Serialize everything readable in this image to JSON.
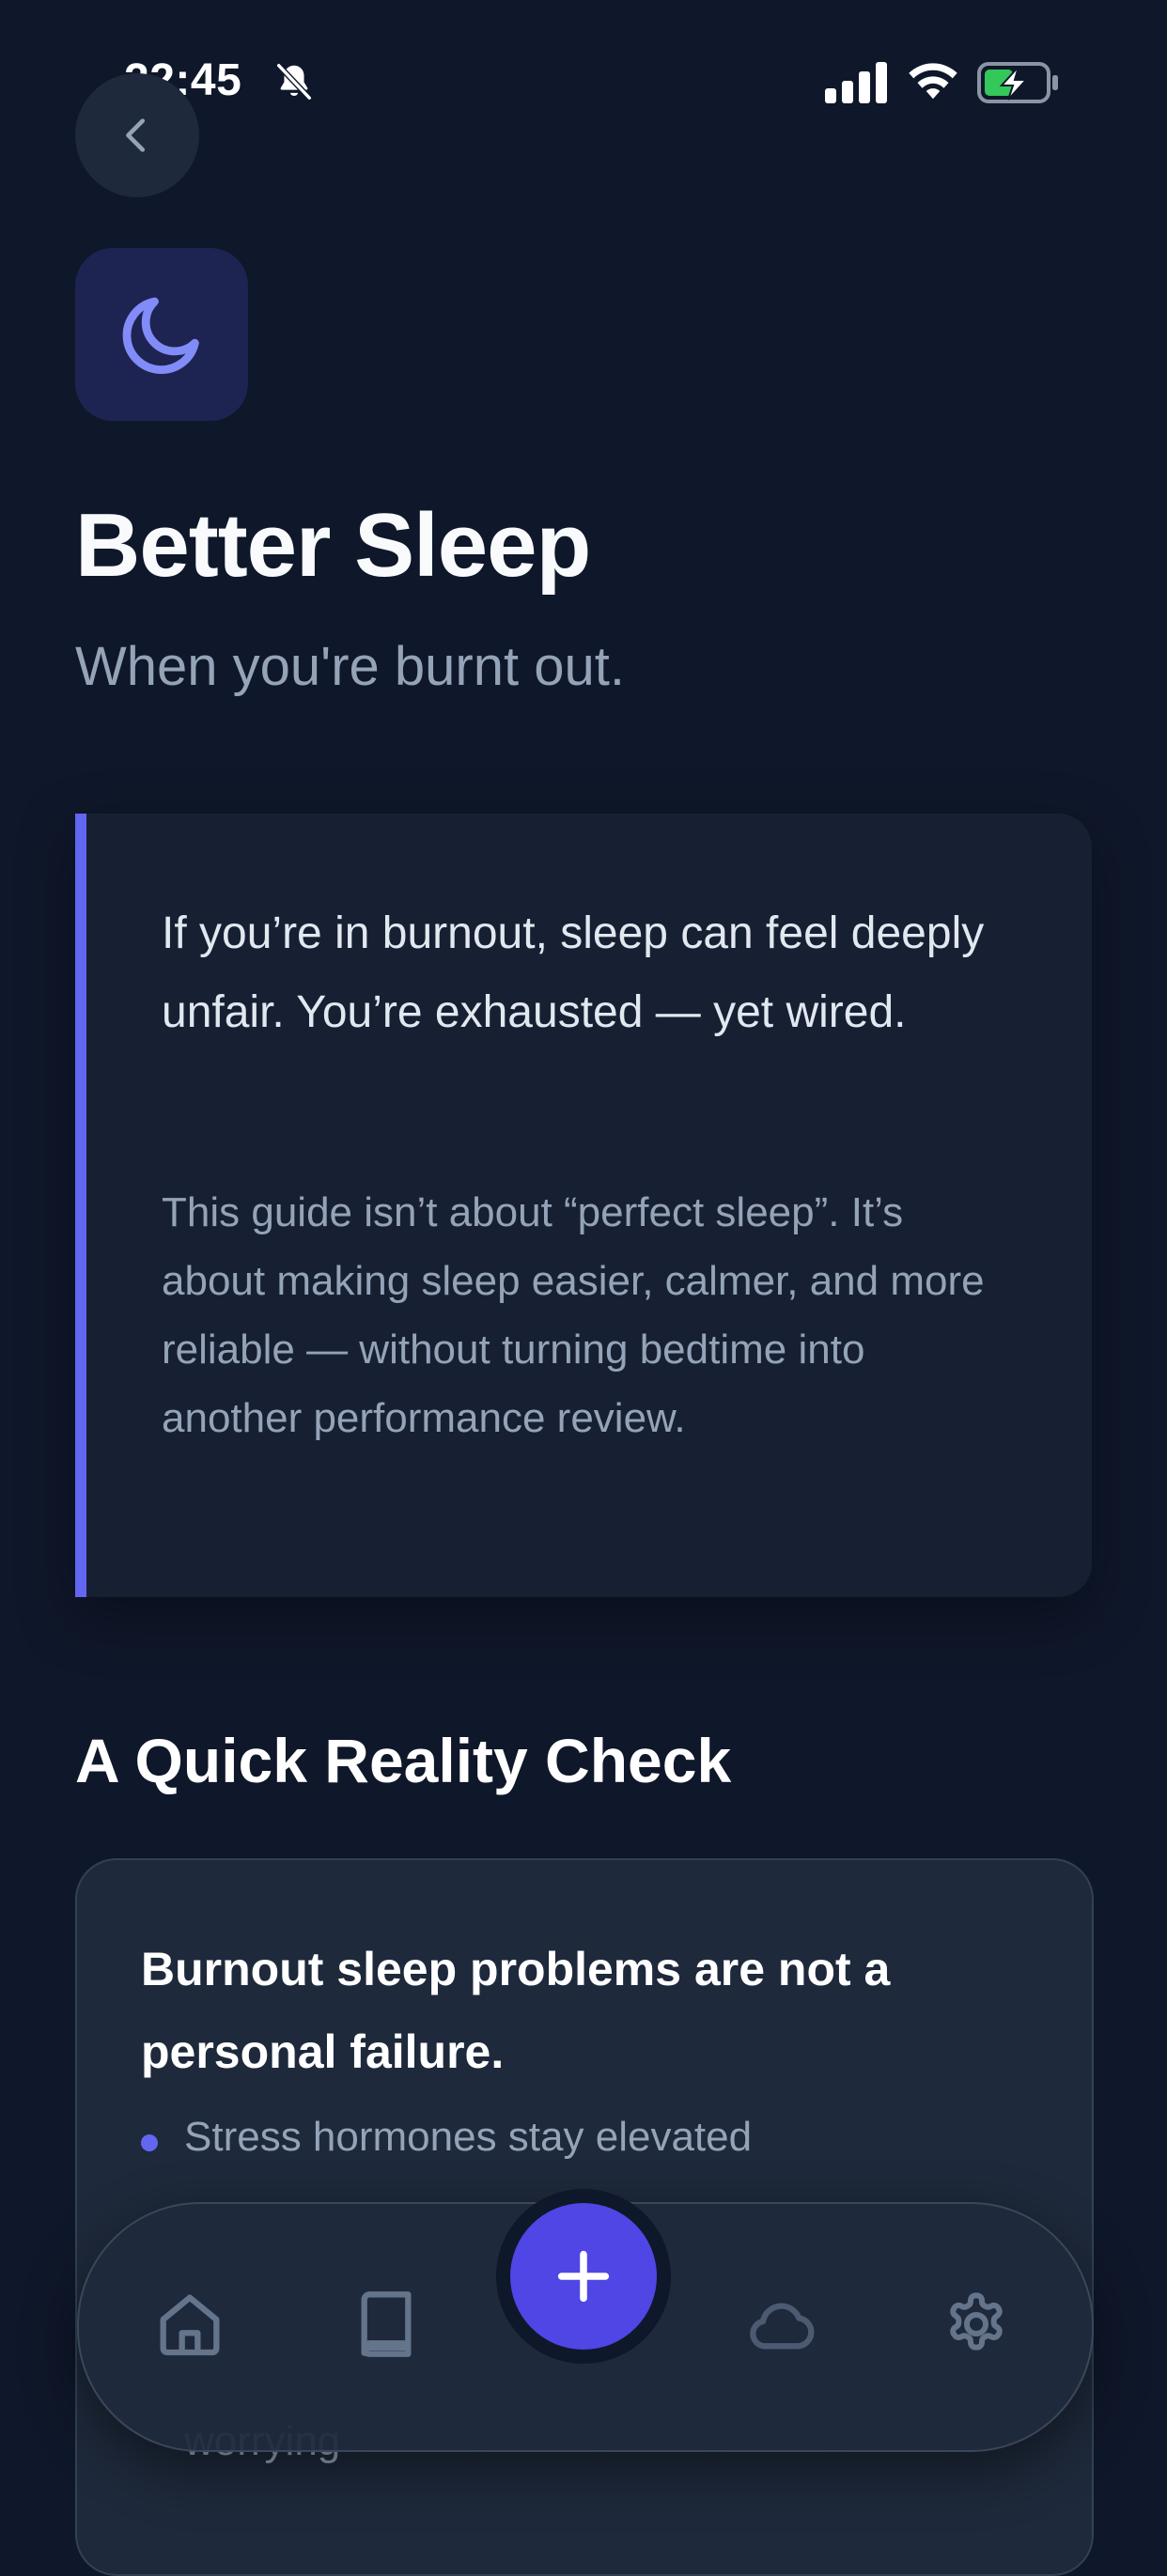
{
  "status_bar": {
    "time": "22:45"
  },
  "icons": {
    "back": "chevron-left-icon",
    "moon": "moon-icon",
    "home": "home-icon",
    "book": "book-icon",
    "add": "plus-icon",
    "cloud": "cloud-icon",
    "settings": "gear-icon"
  },
  "header": {
    "title": "Better Sleep",
    "subtitle": "When you're burnt out."
  },
  "intro": {
    "lead": "If you’re in burnout, sleep can feel deeply unfair. You’re exhausted — yet wired.",
    "body": "This guide isn’t about “perfect sleep”. It’s about making sleep easier, calmer, and more reliable — without turning bedtime into another performance review."
  },
  "reality_check": {
    "heading": "A Quick Reality Check",
    "card_title": "Burnout sleep problems are not a personal failure.",
    "bullets": [
      "Stress hormones stay elevated",
      "worrying"
    ]
  },
  "colors": {
    "background": "#0f172a",
    "card": "#172033",
    "accent": "#6366f1",
    "fab": "#4f46e5",
    "muted_text": "#94a3b8"
  }
}
